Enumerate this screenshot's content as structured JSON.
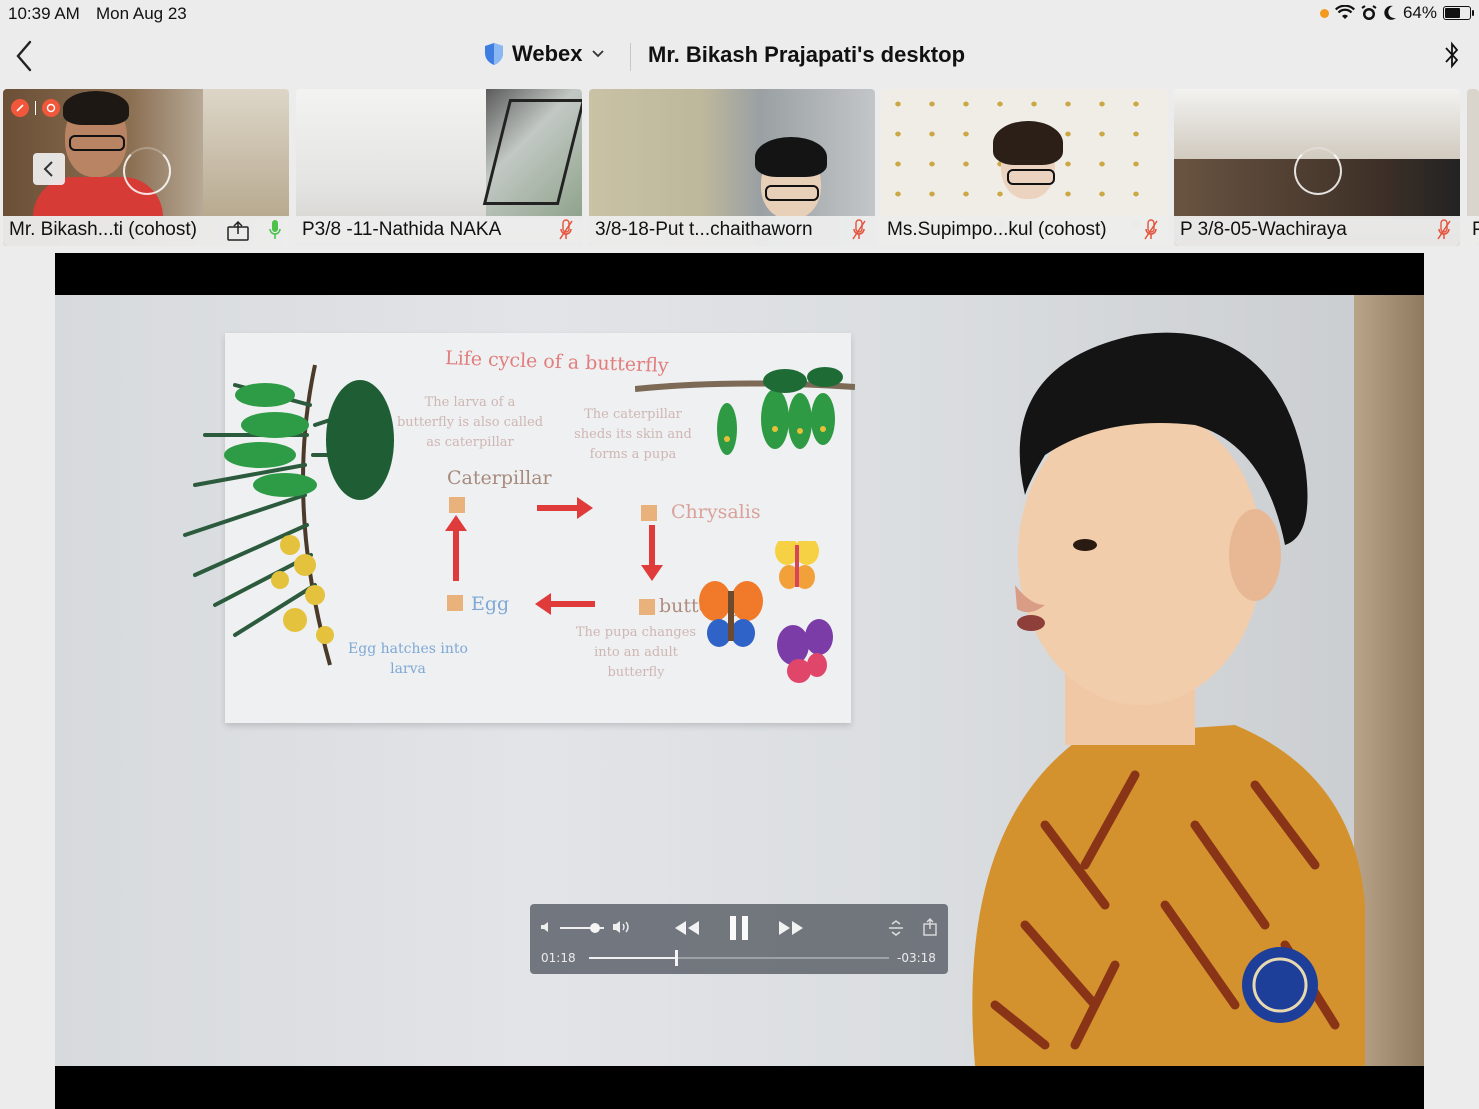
{
  "status_bar": {
    "time": "10:39 AM",
    "date": "Mon Aug 23",
    "battery": "64%",
    "battery_level": 0.64
  },
  "nav": {
    "app": "Webex",
    "title": "Mr. Bikash Prajapati's desktop",
    "icons": [
      "back-icon",
      "shield-icon",
      "chevron-down-icon",
      "bluetooth-icon"
    ]
  },
  "participants": [
    {
      "name": "Mr. Bikash...ti (cohost)",
      "mic": "on",
      "sharing": true
    },
    {
      "name": "P3/8 -11-Nathida NAKA",
      "mic": "muted"
    },
    {
      "name": "3/8-18-Put t...chaithaworn",
      "mic": "muted"
    },
    {
      "name": "Ms.Supimpo...kul (cohost)",
      "mic": "muted"
    },
    {
      "name": "P 3/8-05-Wachiraya",
      "mic": "muted"
    },
    {
      "name": "P"
    }
  ],
  "video": {
    "poster": {
      "title": "Life cycle of a butterfly",
      "stages": [
        "Caterpillar",
        "Chrysalis",
        "butterfly",
        "Egg"
      ],
      "notes": [
        "The larva of a butterfly is also called as caterpillar",
        "The caterpillar sheds its skin and forms a pupa",
        "The pupa changes into an adult butterfly",
        "Egg hatches into larva"
      ]
    },
    "player": {
      "elapsed": "01:18",
      "remaining": "-03:18",
      "progress": 0.29,
      "volume": 0.8,
      "icons": [
        "volume-low-icon",
        "volume-high-icon",
        "rewind-icon",
        "pause-icon",
        "fast-forward-icon",
        "captions-icon",
        "share-icon"
      ]
    }
  },
  "colors": {
    "accent_red": "#f1573a",
    "mic_on": "#4cc24a",
    "arrow_red": "#e03b3b"
  }
}
